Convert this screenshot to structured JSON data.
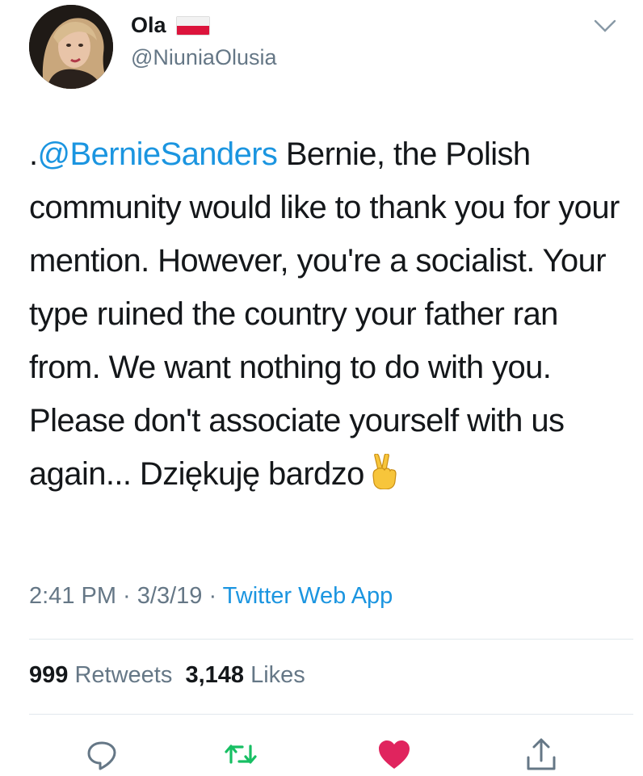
{
  "user": {
    "display_name": "Ola",
    "handle": "@NiuniaOlusia",
    "flag_icon": "poland-flag-icon"
  },
  "tweet": {
    "prefix": ".",
    "mention": "@BernieSanders",
    "text": " Bernie, the Polish community would like to thank you for your mention. However, you're a socialist. Your type ruined the country your father ran from. We want nothing to do with you. Please don't associate yourself with us again... Dziękuję bardzo",
    "emoji_icon": "victory-hand-icon"
  },
  "meta": {
    "time": "2:41 PM",
    "date": "3/3/19",
    "separator": " · ",
    "source": "Twitter Web App"
  },
  "stats": {
    "retweets_count": "999",
    "retweets_label": "Retweets",
    "likes_count": "3,148",
    "likes_label": "Likes"
  },
  "actions": {
    "reply_icon": "reply-icon",
    "retweet_icon": "retweet-icon",
    "like_icon": "heart-icon",
    "share_icon": "share-icon"
  },
  "colors": {
    "link": "#1b95e0",
    "retweet": "#17bf63",
    "like": "#e0245e",
    "muted": "#657786"
  }
}
